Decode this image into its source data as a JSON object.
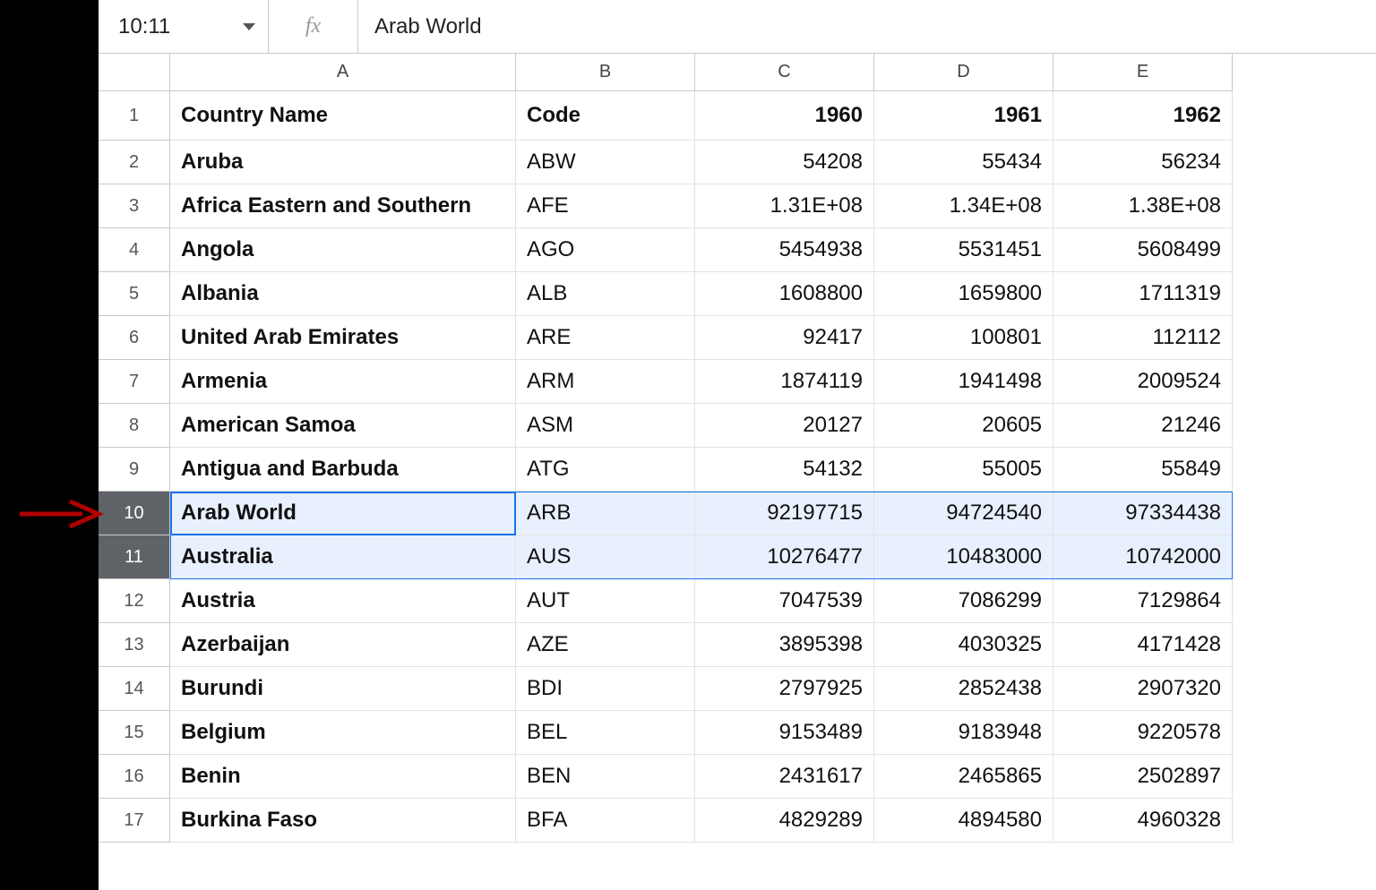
{
  "formulaBar": {
    "nameBox": "10:11",
    "fx": "fx",
    "formula": "Arab World"
  },
  "columns": {
    "A": "A",
    "B": "B",
    "C": "C",
    "D": "D",
    "E": "E"
  },
  "header": {
    "A": "Country Name",
    "B": "Code",
    "C": "1960",
    "D": "1961",
    "E": "1962"
  },
  "rows": [
    {
      "n": "1",
      "A": "Country Name",
      "B": "Code",
      "C": "1960",
      "D": "1961",
      "E": "1962",
      "header": true
    },
    {
      "n": "2",
      "A": "Aruba",
      "B": "ABW",
      "C": "54208",
      "D": "55434",
      "E": "56234"
    },
    {
      "n": "3",
      "A": "Africa Eastern and Southern",
      "B": "AFE",
      "C": "1.31E+08",
      "D": "1.34E+08",
      "E": "1.38E+08"
    },
    {
      "n": "4",
      "A": "Angola",
      "B": "AGO",
      "C": "5454938",
      "D": "5531451",
      "E": "5608499"
    },
    {
      "n": "5",
      "A": "Albania",
      "B": "ALB",
      "C": "1608800",
      "D": "1659800",
      "E": "1711319"
    },
    {
      "n": "6",
      "A": "United Arab Emirates",
      "B": "ARE",
      "C": "92417",
      "D": "100801",
      "E": "112112"
    },
    {
      "n": "7",
      "A": "Armenia",
      "B": "ARM",
      "C": "1874119",
      "D": "1941498",
      "E": "2009524"
    },
    {
      "n": "8",
      "A": "American Samoa",
      "B": "ASM",
      "C": "20127",
      "D": "20605",
      "E": "21246"
    },
    {
      "n": "9",
      "A": "Antigua and Barbuda",
      "B": "ATG",
      "C": "54132",
      "D": "55005",
      "E": "55849"
    },
    {
      "n": "10",
      "A": "Arab World",
      "B": "ARB",
      "C": "92197715",
      "D": "94724540",
      "E": "97334438",
      "selected": true,
      "primary": true
    },
    {
      "n": "11",
      "A": "Australia",
      "B": "AUS",
      "C": "10276477",
      "D": "10483000",
      "E": "10742000",
      "selected": true
    },
    {
      "n": "12",
      "A": "Austria",
      "B": "AUT",
      "C": "7047539",
      "D": "7086299",
      "E": "7129864"
    },
    {
      "n": "13",
      "A": "Azerbaijan",
      "B": "AZE",
      "C": "3895398",
      "D": "4030325",
      "E": "4171428"
    },
    {
      "n": "14",
      "A": "Burundi",
      "B": "BDI",
      "C": "2797925",
      "D": "2852438",
      "E": "2907320"
    },
    {
      "n": "15",
      "A": "Belgium",
      "B": "BEL",
      "C": "9153489",
      "D": "9183948",
      "E": "9220578"
    },
    {
      "n": "16",
      "A": "Benin",
      "B": "BEN",
      "C": "2431617",
      "D": "2465865",
      "E": "2502897"
    },
    {
      "n": "17",
      "A": "Burkina Faso",
      "B": "BFA",
      "C": "4829289",
      "D": "4894580",
      "E": "4960328"
    }
  ],
  "selection": {
    "primaryCell": "A10",
    "range": "10:11"
  }
}
